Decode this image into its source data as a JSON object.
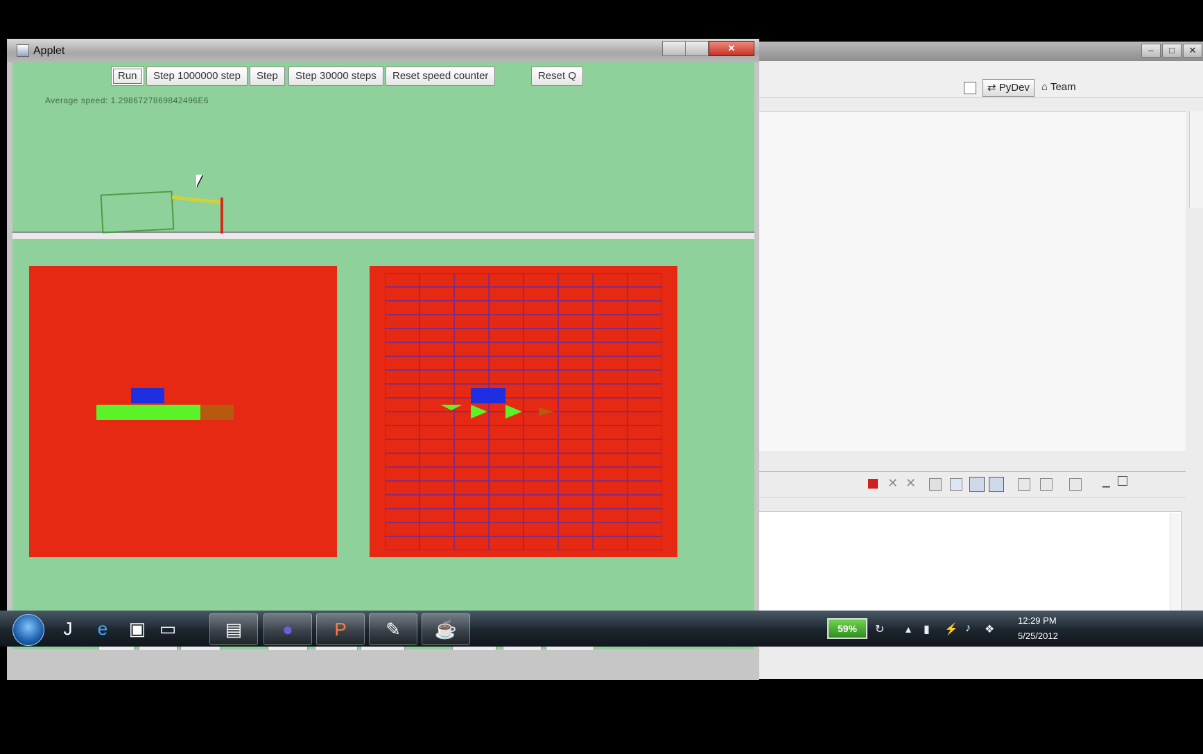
{
  "applet": {
    "title": "Applet",
    "window_buttons": {
      "minimize": "–",
      "maximize": "□",
      "close": "✕"
    },
    "buttons": [
      {
        "label": "Run",
        "focused": true
      },
      {
        "label": "Step 1000000 step"
      },
      {
        "label": "Step"
      },
      {
        "label": "Step 30000 steps"
      },
      {
        "label": "Reset speed counter"
      },
      {
        "label": "Reset Q"
      }
    ],
    "speed_text": "Average speed: 1.2986727869842496E6"
  },
  "eclipse": {
    "perspectives": [
      "PyDev",
      "Team"
    ],
    "window_buttons": {
      "minimize": "–",
      "maximize": "□",
      "close": "✕"
    }
  },
  "colors": {
    "panel_green": "#8fd19a",
    "visual_red": "#e62912",
    "grid_purple": "#6a2a9a",
    "agent_blue": "#1d2fe0",
    "track_green": "#5bf22a",
    "track_brown": "#b75a10"
  },
  "taskbar": {
    "icons": [
      "start-orb-icon",
      "jetbrains-icon",
      "ie-icon",
      "explorer-icon",
      "desktop-icon",
      "folder-icon",
      "eclipse-icon",
      "powerpoint-icon",
      "tool-icon",
      "java-icon"
    ],
    "battery": "59%",
    "clock_time": "12:29 PM",
    "clock_date": "5/25/2012"
  }
}
